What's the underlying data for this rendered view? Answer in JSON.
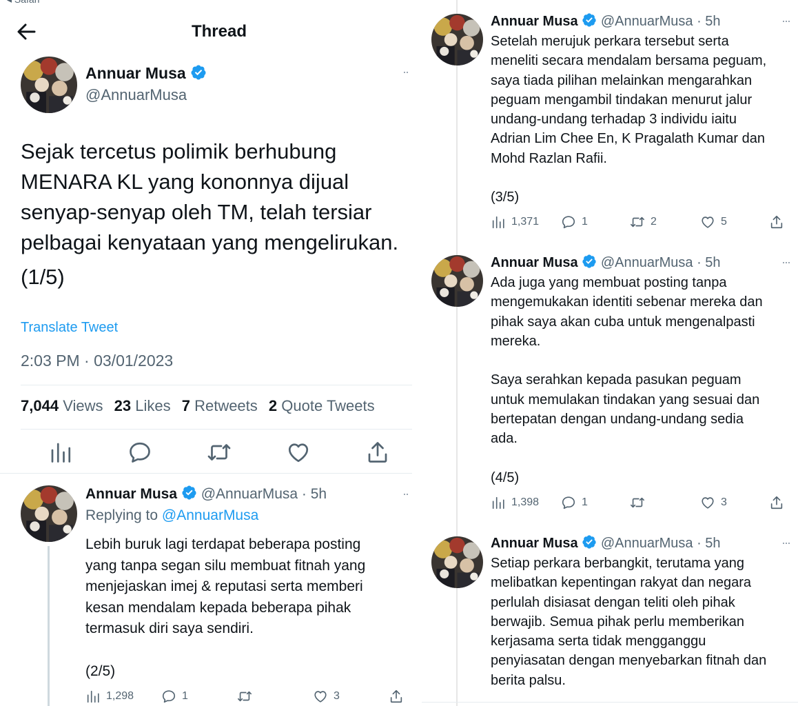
{
  "browser": {
    "back_label": "◂ Safari"
  },
  "header": {
    "title": "Thread"
  },
  "main_tweet": {
    "name": "Annuar Musa",
    "handle": "@AnnuarMusa",
    "text": "Sejak tercetus polimik berhubung\nMENARA KL yang kononnya dijual\nsenyap-senyap oleh TM, telah tersiar\npelbagai kenyataan yang mengelirukan.",
    "part": "(1/5)",
    "translate_label": "Translate Tweet",
    "timestamp": "2:03 PM · 03/01/2023",
    "stats": {
      "views_count": "7,044",
      "views_label": "Views",
      "likes_count": "23",
      "likes_label": "Likes",
      "retweets_count": "7",
      "retweets_label": "Retweets",
      "quotes_count": "2",
      "quotes_label": "Quote Tweets"
    }
  },
  "replies": [
    {
      "name": "Annuar Musa",
      "meta": "@AnnuarMusa · 5h",
      "replying_prefix": "Replying to ",
      "replying_handle": "@AnnuarMusa",
      "text": "Lebih buruk lagi terdapat beberapa posting\nyang tanpa segan silu membuat fitnah yang\nmenjejaskan imej & reputasi serta memberi\nkesan mendalam kepada beberapa pihak\ntermasuk diri saya sendiri.\n\n(2/5)",
      "views": "1,298",
      "replies": "1",
      "retweets": "",
      "likes": "3"
    },
    {
      "name": "Annuar Musa",
      "meta": "@AnnuarMusa · 5h",
      "text": "Setelah merujuk perkara tersebut serta\nmeneliti secara mendalam bersama peguam,\nsaya tiada pilihan melainkan mengarahkan\npeguam mengambil tindakan menurut jalur\nundang-undang terhadap 3 individu iaitu\nAdrian Lim Chee En, K Pragalath Kumar dan\nMohd Razlan Rafii.\n\n(3/5)",
      "views": "1,371",
      "replies": "1",
      "retweets": "2",
      "likes": "5"
    },
    {
      "name": "Annuar Musa",
      "meta": "@AnnuarMusa · 5h",
      "text": "Ada juga yang membuat posting tanpa\nmengemukakan identiti sebenar mereka dan\npihak saya akan cuba untuk mengenalpasti\nmereka.\n\nSaya serahkan kepada pasukan peguam\nuntuk memulakan tindakan yang sesuai dan\nbertepatan dengan undang-undang sedia\nada.\n\n(4/5)",
      "views": "1,398",
      "replies": "1",
      "retweets": "",
      "likes": "3"
    },
    {
      "name": "Annuar Musa",
      "meta": "@AnnuarMusa · 5h",
      "text": "Setiap perkara berbangkit, terutama yang\nmelibatkan kepentingan rakyat dan negara\nperlulah disiasat dengan teliti oleh pihak\nberwajib. Semua pihak perlu memberikan\nkerjasama serta tidak mengganggu\npenyiasatan dengan menyebarkan fitnah dan\nberita palsu."
    }
  ],
  "colors": {
    "accent": "#1d9bf0",
    "muted": "#536471",
    "text": "#0f1419"
  },
  "icons": [
    "back-arrow-icon",
    "verified-badge-icon",
    "more-icon",
    "views-icon",
    "reply-icon",
    "retweet-icon",
    "like-icon",
    "share-icon"
  ]
}
